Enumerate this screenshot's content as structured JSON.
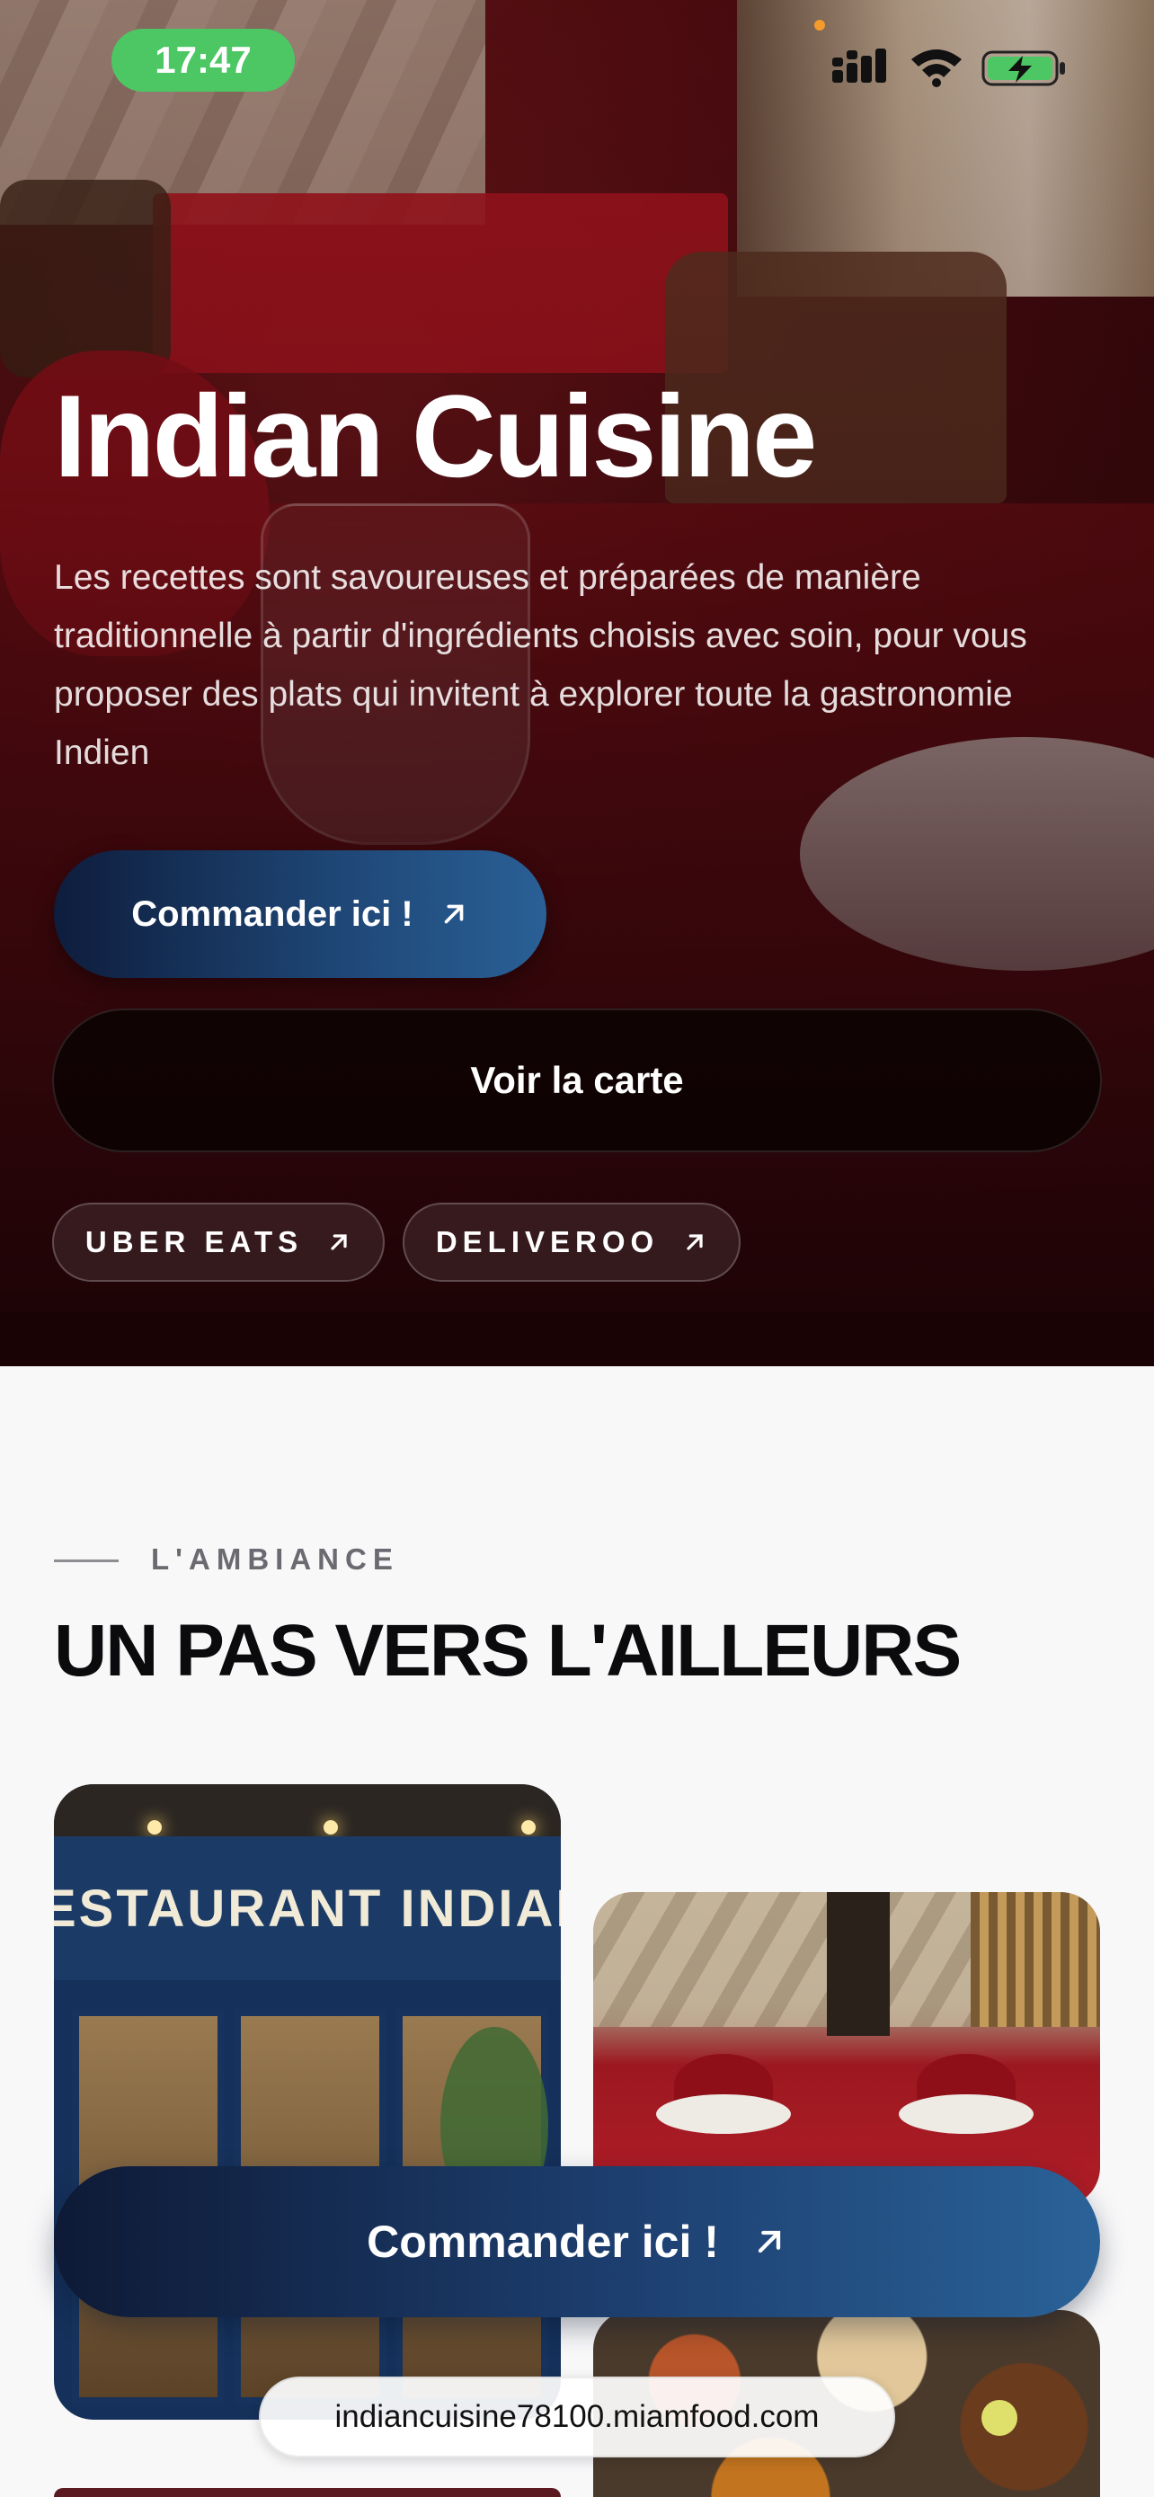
{
  "status_bar": {
    "time": "17:47",
    "battery_color": "#4cc764",
    "icons": [
      "signal-icon",
      "wifi-icon",
      "battery-charging-icon"
    ]
  },
  "hero": {
    "title": "Indian Cuisine",
    "description": "Les recettes sont savoureuses et préparées de manière traditionnelle à partir d'ingrédients choisis avec soin, pour vous proposer des plats qui invitent à explorer toute la gastronomie Indien",
    "order_button": "Commander ici !",
    "menu_button": "Voir la carte",
    "chips": [
      {
        "label": "UBER EATS"
      },
      {
        "label": "DELIVEROO"
      }
    ]
  },
  "ambiance": {
    "eyebrow": "L'AMBIANCE",
    "title": "UN PAS VERS L'AILLEURS",
    "storefront_sign": "ESTAURANT INDIAN CUIS"
  },
  "floating_cta": {
    "label": "Commander ici !"
  },
  "browser": {
    "url": "indiancuisine78100.miamfood.com"
  },
  "colors": {
    "accent_start": "#0e1d3d",
    "accent_end": "#2a6096",
    "hero_red": "#8a1a1f",
    "page_bg": "#f8f8f9"
  }
}
